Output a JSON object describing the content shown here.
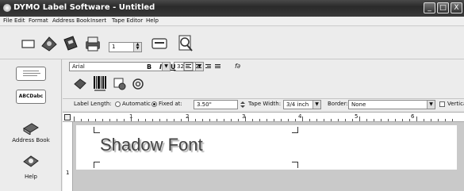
{
  "window": {
    "title": "DYMO Label Software - Untitled",
    "controls": [
      "_",
      "□",
      "X"
    ]
  },
  "menu": [
    "File",
    "Edit",
    "Format",
    "Address Book",
    "Insert",
    "Tape Editor",
    "Help"
  ],
  "toolbar": {
    "copies_value": "1"
  },
  "format": {
    "font_name": "Arial",
    "font_size": "32",
    "bold_label": "B",
    "italic_label": "I",
    "underline_label": "U",
    "fx_label": "f∂"
  },
  "settings": {
    "label_length_label": "Label Length:",
    "automatic_label": "Automatic",
    "fixed_label": "Fixed at:",
    "fixed_value": "3.50\"",
    "tape_width_label": "Tape Width:",
    "tape_width_value": "3/4 inch",
    "border_label": "Border:",
    "border_value": "None",
    "vertical_label": "Vertical Label"
  },
  "ruler": [
    "1",
    "2",
    "3",
    "4",
    "5",
    "6"
  ],
  "sidebar": {
    "label_thumb_1": "",
    "label_thumb_2": "ABCDabc",
    "address_book": "Address Book",
    "help": "Help"
  },
  "label": {
    "text": "Shadow Font"
  },
  "vruler_mark": "1"
}
